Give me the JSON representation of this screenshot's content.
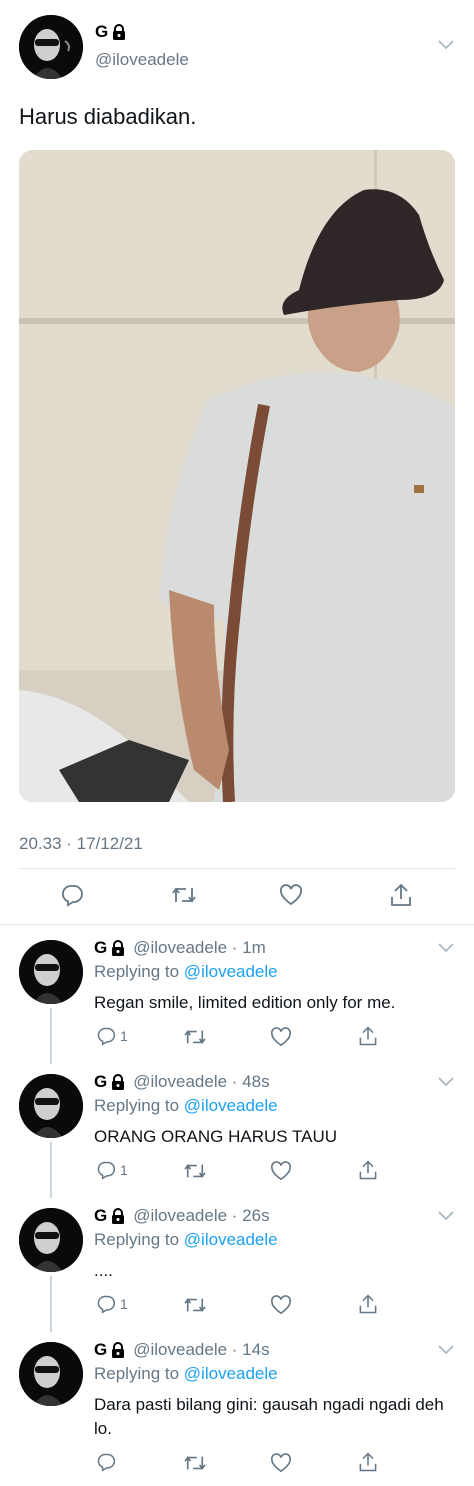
{
  "main_tweet": {
    "display_name": "G",
    "handle": "@iloveadele",
    "text": "Harus diabadikan.",
    "timestamp": "20.33 · 17/12/21"
  },
  "replies": [
    {
      "display_name": "G",
      "meta": "@iloveadele · 1m",
      "replying_prefix": "Replying to",
      "replying_handle": "@iloveadele",
      "text": "Regan smile, limited edition only for me.",
      "reply_count": "1"
    },
    {
      "display_name": "G",
      "meta": "@iloveadele · 48s",
      "replying_prefix": "Replying to",
      "replying_handle": "@iloveadele",
      "text": "ORANG ORANG HARUS TAUU",
      "reply_count": "1"
    },
    {
      "display_name": "G",
      "meta": "@iloveadele · 26s",
      "replying_prefix": "Replying to",
      "replying_handle": "@iloveadele",
      "text": "....",
      "reply_count": "1"
    },
    {
      "display_name": "G",
      "meta": "@iloveadele · 14s",
      "replying_prefix": "Replying to",
      "replying_handle": "@iloveadele",
      "text": "Dara pasti bilang gini: gausah ngadi ngadi deh lo.",
      "reply_count": ""
    }
  ],
  "colors": {
    "link": "#1da1f2",
    "muted": "#657786",
    "divider": "#e1e8ed"
  },
  "icons": [
    "lock-icon",
    "chevron-down-icon",
    "reply-icon",
    "retweet-icon",
    "like-icon",
    "share-icon"
  ]
}
